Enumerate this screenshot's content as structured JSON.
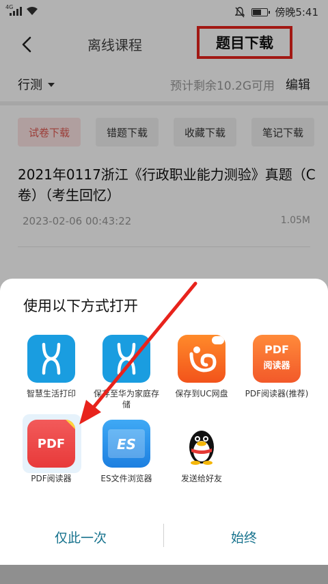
{
  "status_bar": {
    "signal_tag": "4G",
    "time": "傍晚5:41"
  },
  "header": {
    "back_icon": "chevron-left-icon",
    "tab_offline": "离线课程",
    "tab_questions": "题目下载"
  },
  "subbar": {
    "subject": "行测",
    "storage": "预计剩余10.2G可用",
    "edit": "编辑"
  },
  "chips": [
    {
      "label": "试卷下载",
      "active": true
    },
    {
      "label": "错题下载",
      "active": false
    },
    {
      "label": "收藏下载",
      "active": false
    },
    {
      "label": "笔记下载",
      "active": false
    }
  ],
  "file": {
    "title": "2021年0117浙江《行政职业能力测验》真题（C卷）（考生回忆）",
    "date": "2023-02-06 00:43:22",
    "size": "1.05M"
  },
  "sheet": {
    "title": "使用以下方式打开",
    "apps": [
      {
        "label": "智慧生活打印",
        "icon": "huawei-smart-life-icon"
      },
      {
        "label": "保存至华为家庭存储",
        "icon": "huawei-home-storage-icon"
      },
      {
        "label": "保存到UC网盘",
        "icon": "uc-browser-icon"
      },
      {
        "label": "PDF阅读器(推荐)",
        "icon": "pdf-reader-recommended-icon",
        "icon_text": "PDF",
        "icon_sub": "阅读器"
      },
      {
        "label": "PDF阅读器",
        "icon": "pdf-reader-icon",
        "icon_text": "PDF"
      },
      {
        "label": "ES文件浏览器",
        "icon": "es-file-explorer-icon",
        "icon_text": "ES"
      },
      {
        "label": "发送给好友",
        "icon": "qq-penguin-icon"
      }
    ],
    "btn_once": "仅此一次",
    "btn_always": "始终"
  },
  "colors": {
    "highlight_red": "#e8231c",
    "accent_teal": "#16728d",
    "chip_active_text": "#e05a52"
  }
}
